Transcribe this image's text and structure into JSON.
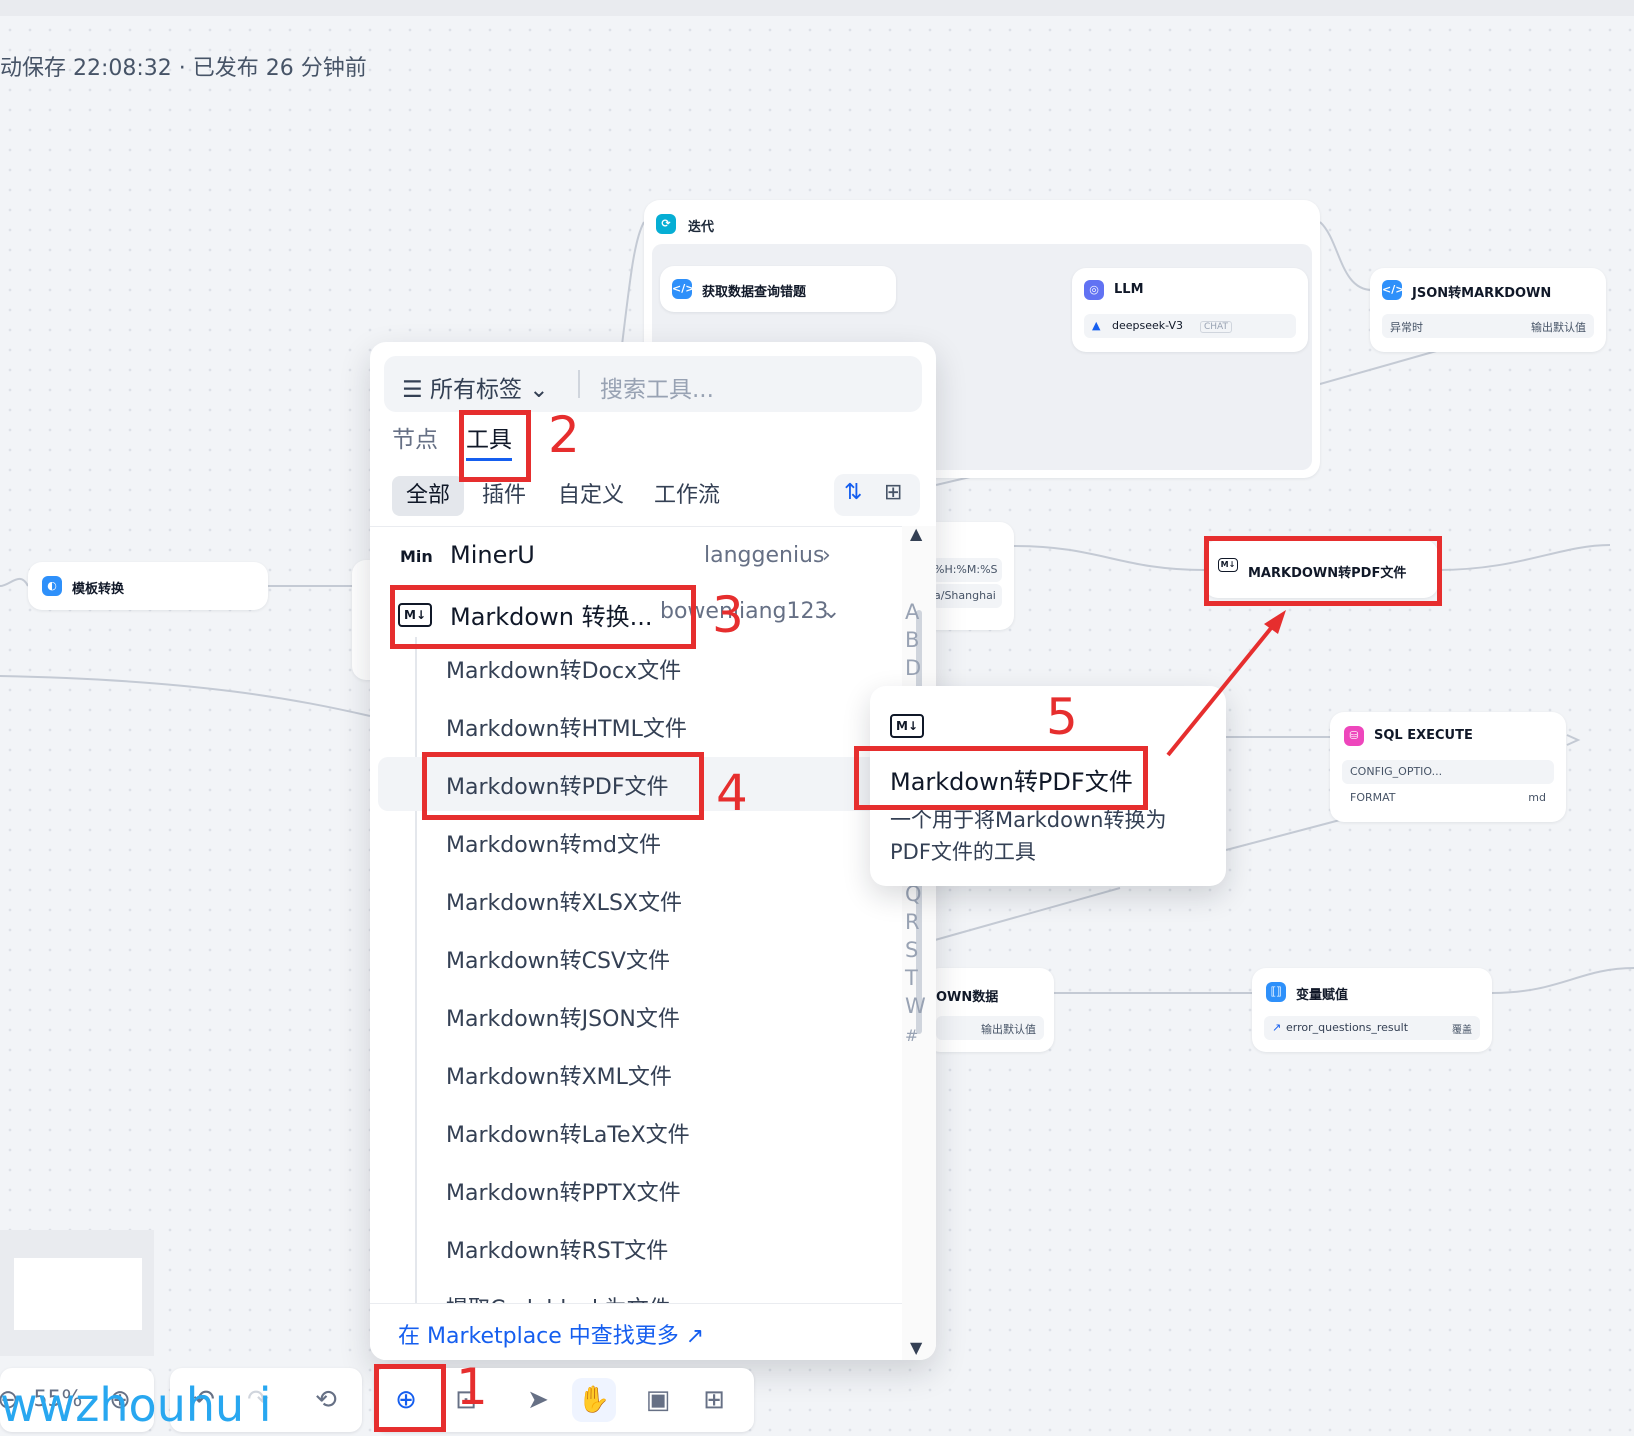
{
  "header": {
    "save_status": "动保存 22:08:32 · 已发布 26 分钟前"
  },
  "nodes": {
    "iteration": {
      "title": "迭代",
      "icon": "iteration-icon"
    },
    "get_data": {
      "title": "获取数据查询错题",
      "icon": "code-icon"
    },
    "llm": {
      "title": "LLM",
      "model": "deepseek-V3",
      "model_tag": "CHAT",
      "icon": "llm-icon"
    },
    "json_md": {
      "title": "JSON转MARKDOWN",
      "row_left": "异常时",
      "row_right": "输出默认值",
      "icon": "code-icon"
    },
    "template": {
      "title": "模板转换",
      "icon": "template-icon"
    },
    "time": {
      "row1": "%H:%M:%S",
      "row2": "a/Shanghai"
    },
    "md_pdf": {
      "title": "MARKDOWN转PDF文件",
      "icon": "markdown-icon"
    },
    "sql": {
      "title": "SQL EXECUTE",
      "row1": "CONFIG_OPTIO...",
      "row2_left": "FORMAT",
      "row2_right": "md",
      "icon": "database-icon"
    },
    "md_data": {
      "title": "OWN数据",
      "row": "输出默认值"
    },
    "var_assign": {
      "title": "变量赋值",
      "var": "error_questions_result",
      "tag": "覆盖",
      "icon": "variable-icon"
    }
  },
  "picker": {
    "tag_filter": "所有标签",
    "search_placeholder": "搜索工具...",
    "tabs": [
      "节点",
      "工具"
    ],
    "active_tab": "工具",
    "sub_tabs": [
      "全部",
      "插件",
      "自定义",
      "工作流"
    ],
    "providers": [
      {
        "name": "MinerU",
        "author": "langgenius",
        "icon": "Min"
      },
      {
        "name": "Markdown 转换...",
        "author": "bowenliang123",
        "icon": "M↓"
      }
    ],
    "tools": [
      "Markdown转Docx文件",
      "Markdown转HTML文件",
      "Markdown转PDF文件",
      "Markdown转md文件",
      "Markdown转XLSX文件",
      "Markdown转CSV文件",
      "Markdown转JSON文件",
      "Markdown转XML文件",
      "Markdown转LaTeX文件",
      "Markdown转PPTX文件",
      "Markdown转RST文件",
      "提取Codeblock为文件"
    ],
    "selected_tool": "Markdown转PDF文件",
    "footer_link": "在 Marketplace 中查找更多 ↗",
    "index_letters": [
      "A",
      "B",
      "D",
      "Q",
      "R",
      "S",
      "T",
      "W",
      "#"
    ]
  },
  "tooltip": {
    "icon": "M↓",
    "title": "Markdown转PDF文件",
    "description": "一个用于将Markdown转换为PDF文件的工具"
  },
  "toolbar": {
    "zoom": "55%"
  },
  "annotations": {
    "numbers": [
      "1",
      "2",
      "3",
      "4",
      "5"
    ],
    "color": "#e62e2e"
  },
  "watermark": "wwzhouhu i"
}
